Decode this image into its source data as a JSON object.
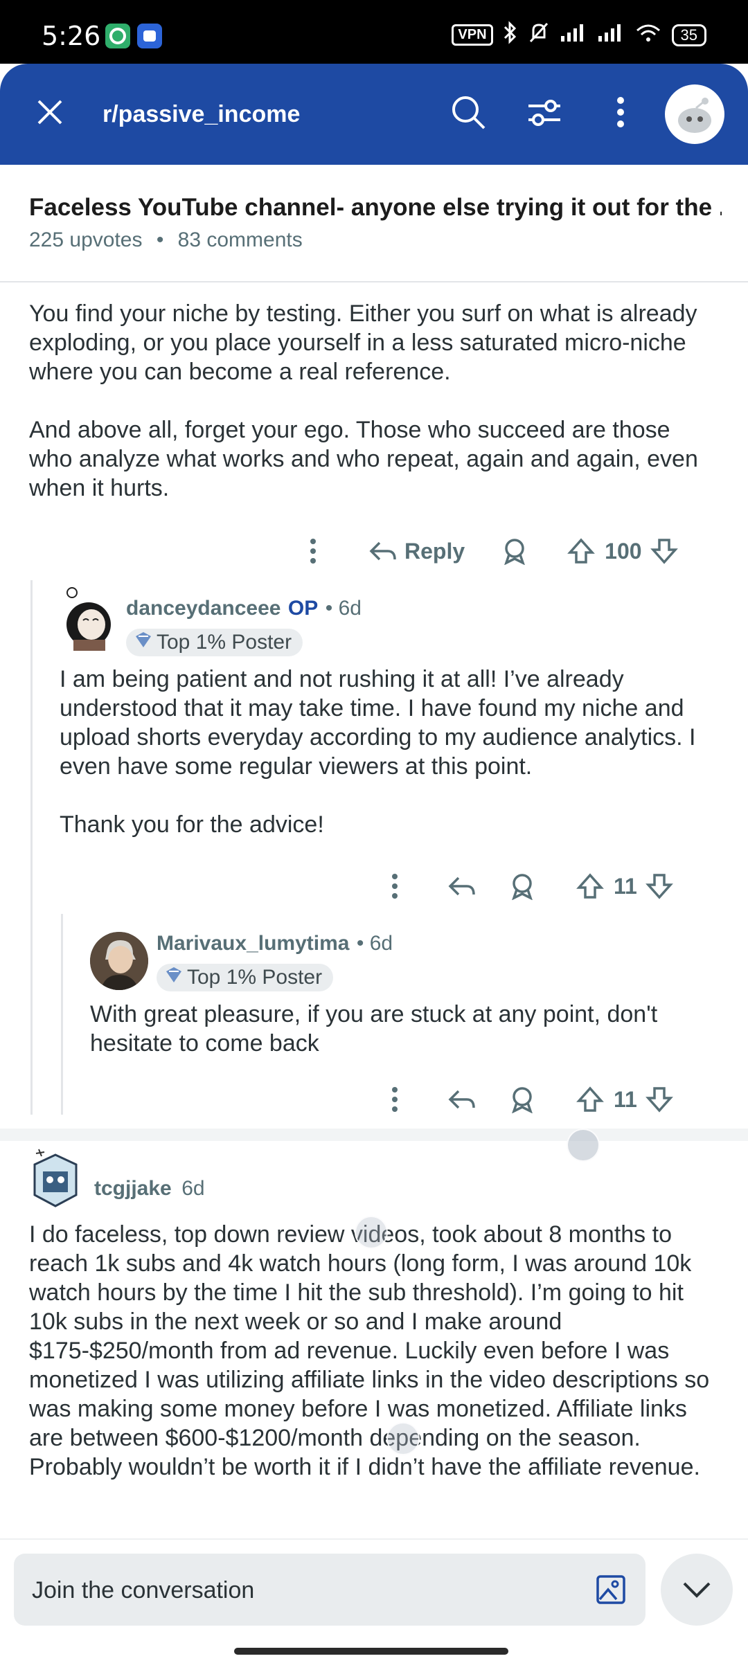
{
  "status_bar": {
    "time": "5:26",
    "vpn": "VPN",
    "battery": "35"
  },
  "header": {
    "subreddit": "r/passive_income"
  },
  "post": {
    "title": "Faceless YouTube channel- anyone else trying it out for the ...",
    "upvotes": "225 upvotes",
    "separator": "•",
    "comments": "83 comments"
  },
  "comments": [
    {
      "text_para1": "You find your niche by testing. Either you surf on what is already exploding, or you place yourself in a less saturated micro-niche where you can become a real reference.",
      "text_para2": "And above all, forget your ego. Those who succeed are those who analyze what works and who repeat, again and again, even when it hurts.",
      "reply_label": "Reply",
      "votes": "100"
    },
    {
      "username": "danceydanceee",
      "op_badge": "OP",
      "age": "• 6d",
      "flair": "Top 1% Poster",
      "text_para1": "I am being patient and not rushing it at all! I’ve already understood that it may take time. I have found my niche and upload shorts everyday according to my audience analytics. I even have some regular viewers at this point.",
      "text_para2": "Thank you for the advice!",
      "votes": "11"
    },
    {
      "username": "Marivaux_lumytima",
      "age": "• 6d",
      "flair": "Top 1% Poster",
      "text": "With great pleasure, if you are stuck at any point, don't hesitate to come back",
      "votes": "11"
    },
    {
      "username": "tcgjjake",
      "age": "6d",
      "text": "I do faceless, top down review videos, took about 8 months to reach 1k subs and 4k watch hours (long form, I was around 10k watch hours by the time I hit the sub threshold). I’m going to hit 10k subs in the next week or so and I make around $175-$250/month from ad revenue. Luckily even before I was monetized I was utilizing affiliate links in the video descriptions so was making some money before I was monetized. Affiliate links are between $600-$1200/month depending on the season. Probably wouldn’t be worth it if I didn’t have the affiliate revenue."
    }
  ],
  "composer": {
    "placeholder": "Join the conversation"
  },
  "colors": {
    "header": "#1e4aa3",
    "op_badge": "#1e4aa3",
    "meta": "#576f76"
  }
}
